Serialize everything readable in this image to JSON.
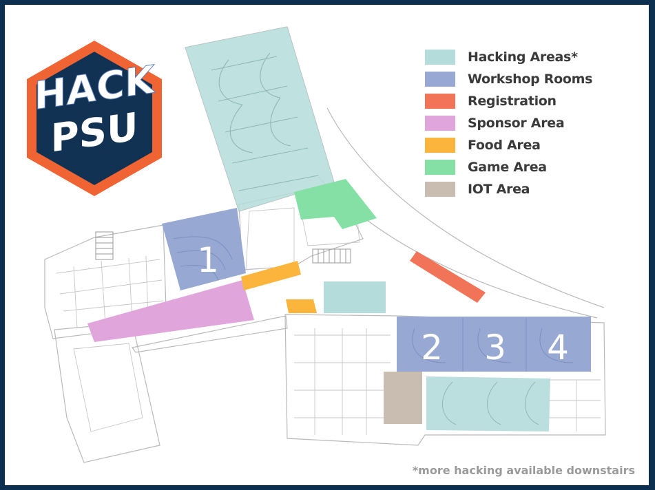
{
  "logo": {
    "line1": "HACK",
    "line2": "PSU",
    "colors": {
      "outer": "#f06434",
      "inner": "#123253",
      "accent": "#5a7cb8"
    }
  },
  "legend": [
    {
      "label": "Hacking Areas*",
      "color": "#b4dcda"
    },
    {
      "label": "Workshop Rooms",
      "color": "#97a8d2"
    },
    {
      "label": "Registration",
      "color": "#f27458"
    },
    {
      "label": "Sponsor Area",
      "color": "#e0a6dc"
    },
    {
      "label": "Food Area",
      "color": "#fbb43c"
    },
    {
      "label": "Game Area",
      "color": "#84e0a4"
    },
    {
      "label": "IOT Area",
      "color": "#c9bdb2"
    }
  ],
  "rooms": {
    "room1": "1",
    "room2": "2",
    "room3": "3",
    "room4": "4"
  },
  "footnote": "*more hacking available downstairs"
}
